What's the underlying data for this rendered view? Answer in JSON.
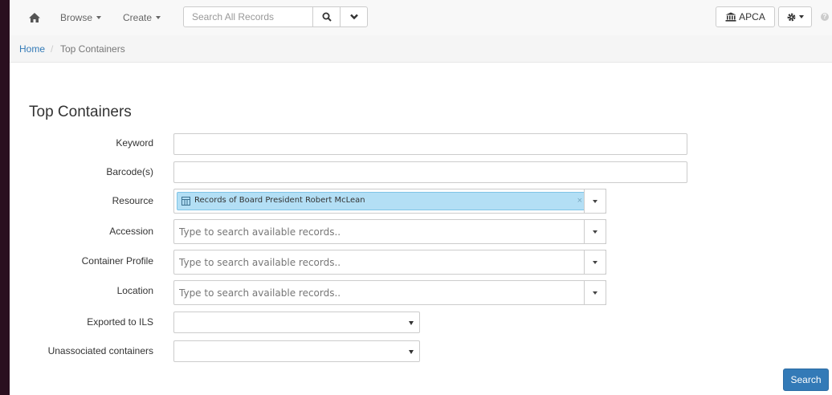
{
  "navbar": {
    "browse_label": "Browse",
    "create_label": "Create",
    "search_placeholder": "Search All Records",
    "repository_label": "APCA"
  },
  "breadcrumb": {
    "home_label": "Home",
    "separator": "/",
    "current_label": "Top Containers"
  },
  "page_title": "Top Containers",
  "form": {
    "keyword": {
      "label": "Keyword",
      "value": ""
    },
    "barcodes": {
      "label": "Barcode(s)",
      "value": ""
    },
    "resource": {
      "label": "Resource",
      "selected": "Records of Board President Robert McLean",
      "remove_glyph": "×"
    },
    "accession": {
      "label": "Accession",
      "placeholder": "Type to search available records.."
    },
    "container_profile": {
      "label": "Container Profile",
      "placeholder": "Type to search available records.."
    },
    "location": {
      "label": "Location",
      "placeholder": "Type to search available records.."
    },
    "exported_to_ils": {
      "label": "Exported to ILS",
      "value": ""
    },
    "unassociated_containers": {
      "label": "Unassociated containers",
      "value": ""
    }
  },
  "search_button_label": "Search",
  "colors": {
    "accent": "#337ab7",
    "token_background": "#b3dff5",
    "outer_background": "#2a0f1f"
  },
  "icons": [
    "home-icon",
    "search-icon",
    "chevron-down-icon",
    "bank-icon",
    "gear-icon",
    "help-icon",
    "grid-icon"
  ]
}
